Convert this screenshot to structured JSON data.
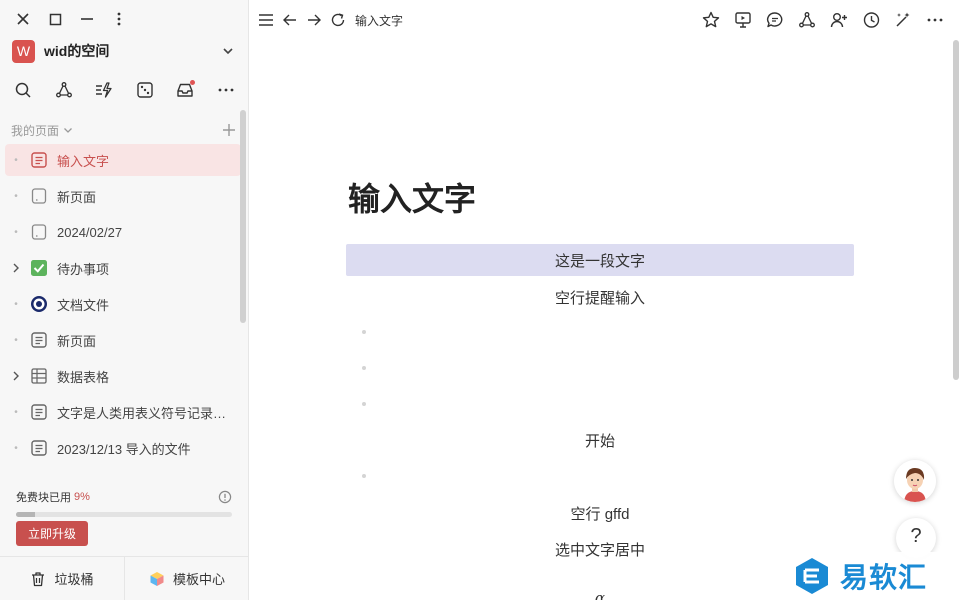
{
  "window": {
    "controls": [
      "close-icon",
      "maximize-icon",
      "minimize-icon",
      "more-vertical-icon"
    ]
  },
  "space": {
    "logo_letter": "W",
    "name": "wid的空间",
    "logo_color": "#d9534f"
  },
  "toolbar_icons": [
    "search-icon",
    "graph-icon",
    "quick-action-icon",
    "dice-icon",
    "inbox-icon",
    "more-icon"
  ],
  "sidebar": {
    "section_label": "我的页面",
    "items": [
      {
        "label": "输入文字",
        "icon": "doc-icon",
        "active": true,
        "expandable": false
      },
      {
        "label": "新页面",
        "icon": "blank-doc-icon",
        "active": false,
        "expandable": false
      },
      {
        "label": "2024/02/27",
        "icon": "blank-doc-icon",
        "active": false,
        "expandable": false
      },
      {
        "label": "待办事项",
        "icon": "checkbox-icon",
        "active": false,
        "expandable": true
      },
      {
        "label": "文档文件",
        "icon": "target-icon",
        "active": false,
        "expandable": false
      },
      {
        "label": "新页面",
        "icon": "doc-icon",
        "active": false,
        "expandable": false
      },
      {
        "label": "数据表格",
        "icon": "table-icon",
        "active": false,
        "expandable": true
      },
      {
        "label": "文字是人类用表义符号记录表达...",
        "icon": "doc-icon",
        "active": false,
        "expandable": false
      },
      {
        "label": "2023/12/13 导入的文件",
        "icon": "doc-icon",
        "active": false,
        "expandable": false
      }
    ],
    "usage": {
      "label": "免费块已用",
      "percent_text": "9%",
      "fraction": 0.09
    },
    "upgrade_label": "立即升级",
    "bottom": {
      "trash_label": "垃圾桶",
      "template_label": "模板中心"
    }
  },
  "topbar": {
    "breadcrumb": "输入文字",
    "nav_icons": [
      "menu-icon",
      "back-arrow-icon",
      "forward-arrow-icon",
      "refresh-icon"
    ],
    "right_icons": [
      "star-icon",
      "present-icon",
      "comment-icon",
      "graph-icon",
      "add-user-icon",
      "history-icon",
      "magic-icon",
      "more-icon"
    ]
  },
  "document": {
    "title": "输入文字",
    "blocks": {
      "b1": "这是一段文字",
      "b2": "空行提醒输入",
      "b3": "开始",
      "b4": "空行 gffd",
      "b5": "选中文字居中",
      "b6": "α"
    }
  },
  "watermark": {
    "text": "易软汇"
  },
  "colors": {
    "accent": "#c8504e",
    "selection": "#dcdcf1",
    "active_item_bg": "#f9e4e4",
    "watermark_blue": "#1a8ad4"
  }
}
